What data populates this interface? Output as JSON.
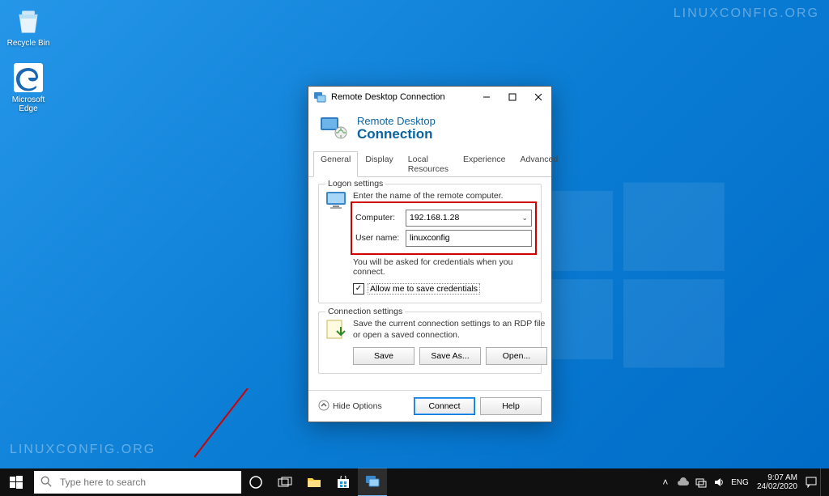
{
  "desktop": {
    "icons": {
      "recycle": "Recycle Bin",
      "edge": "Microsoft Edge"
    },
    "watermark": "LINUXCONFIG.ORG"
  },
  "dialog": {
    "title": "Remote Desktop Connection",
    "banner_line1": "Remote Desktop",
    "banner_line2": "Connection",
    "tabs": [
      "General",
      "Display",
      "Local Resources",
      "Experience",
      "Advanced"
    ],
    "logon": {
      "group_title": "Logon settings",
      "instruction": "Enter the name of the remote computer.",
      "computer_label": "Computer:",
      "computer_value": "192.168.1.28",
      "username_label": "User name:",
      "username_value": "linuxconfig",
      "cred_hint": "You will be asked for credentials when you connect.",
      "allow_save_label": "Allow me to save credentials",
      "allow_save_checked": true
    },
    "conn": {
      "group_title": "Connection settings",
      "text": "Save the current connection settings to an RDP file or open a saved connection.",
      "save": "Save",
      "save_as": "Save As...",
      "open": "Open..."
    },
    "footer": {
      "hide_options": "Hide Options",
      "connect": "Connect",
      "help": "Help"
    }
  },
  "taskbar": {
    "search_placeholder": "Type here to search",
    "lang": "ENG",
    "time": "9:07 AM",
    "date": "24/02/2020"
  }
}
